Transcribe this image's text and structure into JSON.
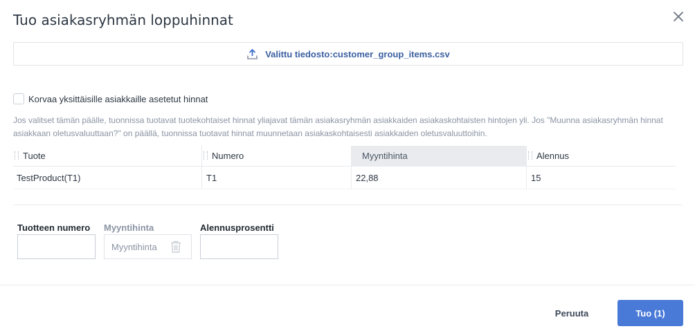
{
  "dialog": {
    "title": "Tuo asiakasryhmän loppuhinnat"
  },
  "upload": {
    "label": "Valittu tiedosto:customer_group_items.csv"
  },
  "override": {
    "checked": false,
    "label": "Korvaa yksittäisille asiakkaille asetetut hinnat",
    "help": "Jos valitset tämän päälle, tuonnissa tuotavat tuotekohtaiset hinnat yliajavat tämän asiakasryhmän asiakkaiden asiakaskohtaisten hintojen yli. Jos \"Muunna asiakasryhmän hinnat asiakkaan oletusvaluuttaan?\" on päällä, tuonnissa tuotavat hinnat muunnetaan asiakaskohtaisesti asiakkaiden oletusvaluuttoihin."
  },
  "table": {
    "columns": [
      "Tuote",
      "Numero",
      "Myyntihinta",
      "Alennus"
    ],
    "rows": [
      [
        "TestProduct(T1)",
        "T1",
        "22,88",
        "15"
      ]
    ]
  },
  "mapping": {
    "product_number_label": "Tuotteen numero",
    "sales_price_label": "Myyntihinta",
    "sales_price_placeholder": "Myyntihinta",
    "discount_label": "Alennusprosentti"
  },
  "footer": {
    "cancel_label": "Peruuta",
    "import_label": "Tuo (1)"
  },
  "icons": {
    "close": "close-icon",
    "upload": "upload-icon",
    "trash": "trash-icon"
  },
  "colors": {
    "primary": "#4a7ad8",
    "link": "#3a5fa0"
  }
}
